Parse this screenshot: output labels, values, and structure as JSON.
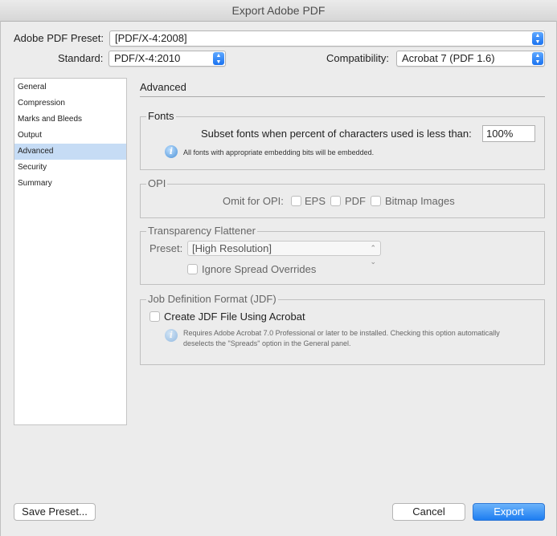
{
  "window": {
    "title": "Export Adobe PDF"
  },
  "header": {
    "preset_label": "Adobe PDF Preset:",
    "preset_value": "[PDF/X-4:2008]",
    "standard_label": "Standard:",
    "standard_value": "PDF/X-4:2010",
    "compat_label": "Compatibility:",
    "compat_value": "Acrobat 7 (PDF 1.6)"
  },
  "sidebar": {
    "items": [
      {
        "label": "General"
      },
      {
        "label": "Compression"
      },
      {
        "label": "Marks and Bleeds"
      },
      {
        "label": "Output"
      },
      {
        "label": "Advanced"
      },
      {
        "label": "Security"
      },
      {
        "label": "Summary"
      }
    ],
    "selected": "Advanced"
  },
  "main": {
    "title": "Advanced",
    "fonts": {
      "title": "Fonts",
      "subset_label": "Subset fonts when percent of characters used is less than:",
      "subset_value": "100%",
      "info": "All fonts with appropriate embedding bits will be embedded."
    },
    "opi": {
      "title": "OPI",
      "omit_label": "Omit for OPI:",
      "eps": "EPS",
      "pdf": "PDF",
      "bitmap": "Bitmap Images"
    },
    "transparency": {
      "title": "Transparency Flattener",
      "preset_label": "Preset:",
      "preset_value": "[High Resolution]",
      "ignore_label": "Ignore Spread Overrides"
    },
    "jdf": {
      "title": "Job Definition Format (JDF)",
      "create_label": "Create JDF File Using Acrobat",
      "info_line1": "Requires Adobe Acrobat 7.0 Professional or later to be installed. Checking this option automatically",
      "info_line2": "deselects the \"Spreads\" option in the General panel."
    }
  },
  "footer": {
    "save_preset": "Save Preset...",
    "cancel": "Cancel",
    "export": "Export"
  }
}
